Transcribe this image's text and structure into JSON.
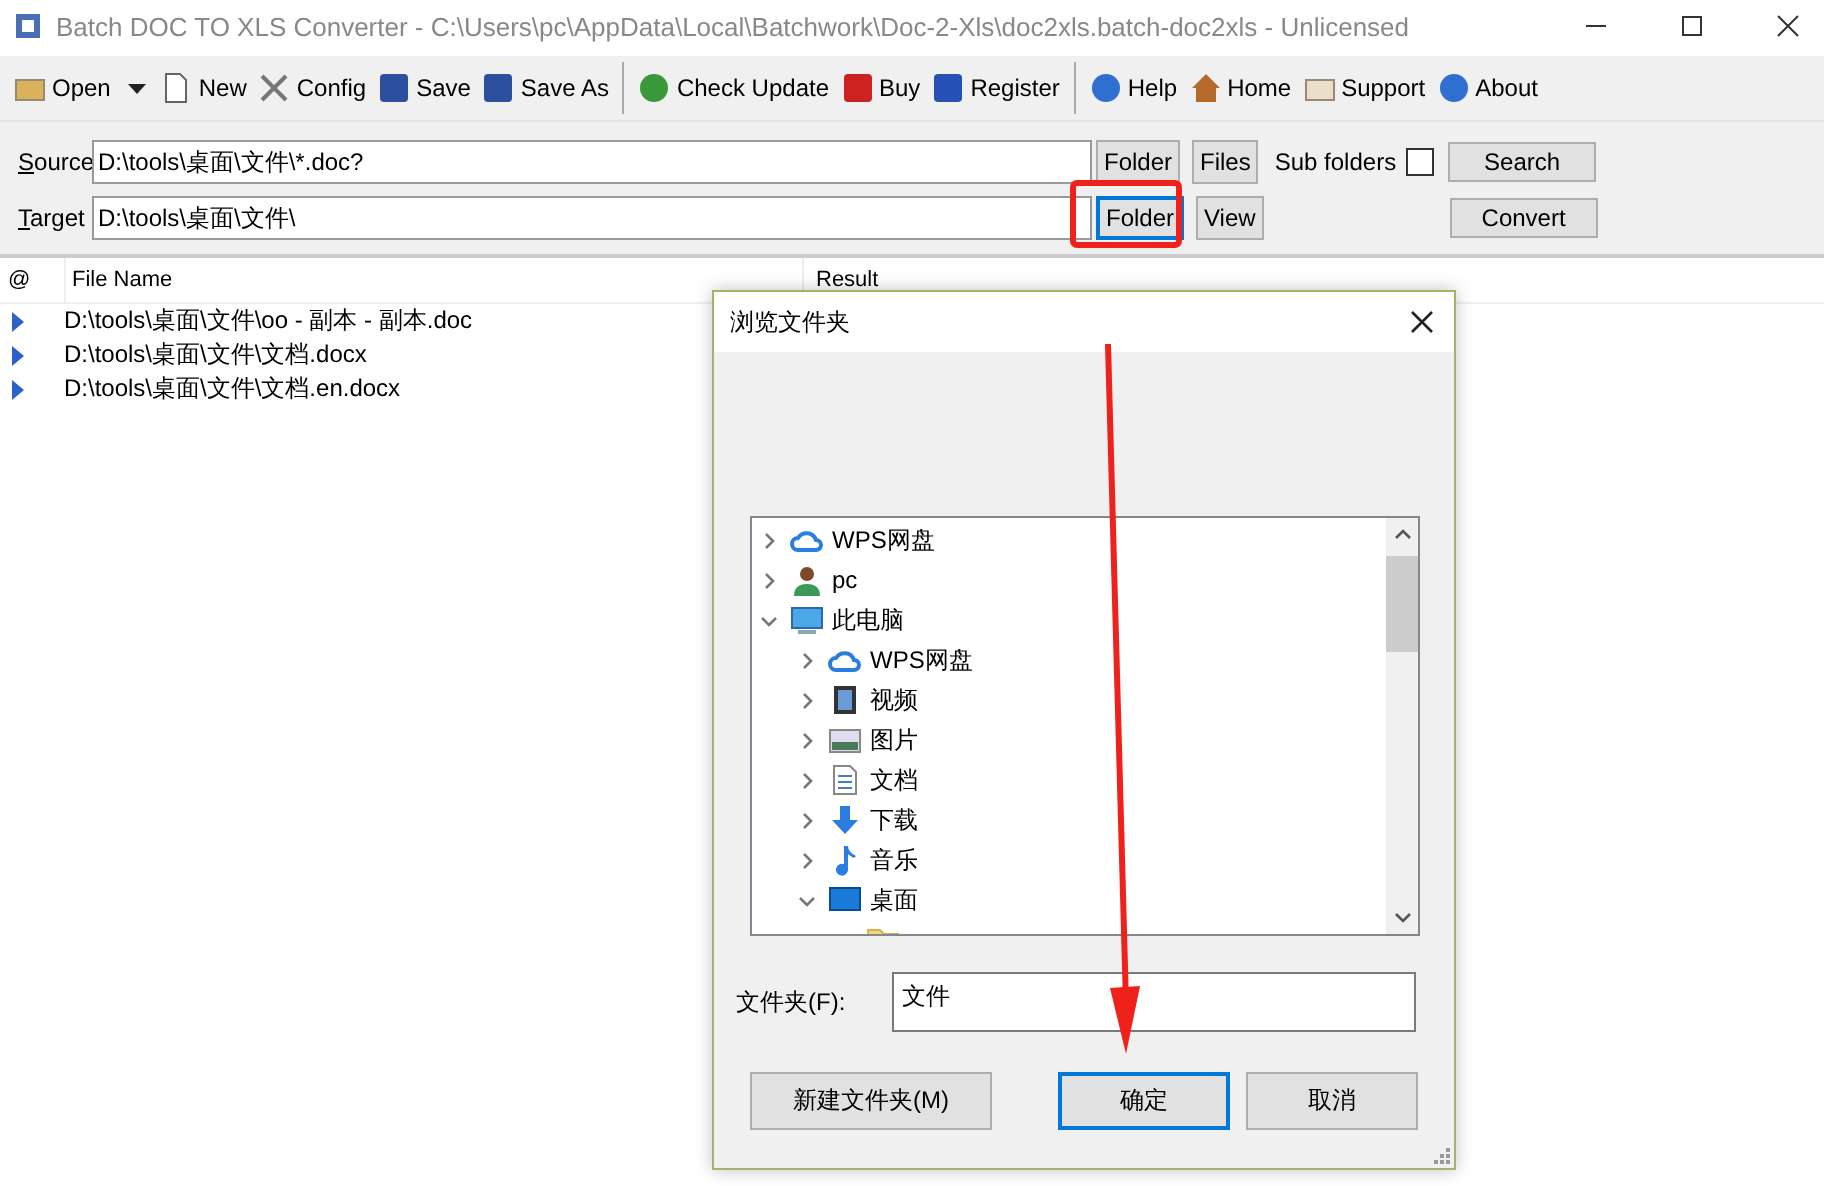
{
  "window": {
    "title": "Batch DOC TO XLS Converter - C:\\Users\\pc\\AppData\\Local\\Batchwork\\Doc-2-Xls\\doc2xls.batch-doc2xls - Unlicensed"
  },
  "toolbar": [
    [
      {
        "label": "Open",
        "kind": "open",
        "dropdown": true
      },
      {
        "label": "New",
        "kind": "new",
        "dropdown": false
      },
      {
        "label": "Config",
        "kind": "config",
        "dropdown": false
      },
      {
        "label": "Save",
        "kind": "save",
        "dropdown": false
      },
      {
        "label": "Save As",
        "kind": "saveas",
        "dropdown": false
      }
    ],
    [
      {
        "label": "Check Update",
        "kind": "update",
        "dropdown": false
      },
      {
        "label": "Buy",
        "kind": "buy",
        "dropdown": false
      },
      {
        "label": "Register",
        "kind": "register",
        "dropdown": false
      }
    ],
    [
      {
        "label": "Help",
        "kind": "help",
        "dropdown": false
      },
      {
        "label": "Home",
        "kind": "home",
        "dropdown": false
      },
      {
        "label": "Support",
        "kind": "support",
        "dropdown": false
      },
      {
        "label": "About",
        "kind": "about",
        "dropdown": false
      }
    ]
  ],
  "form": {
    "source": {
      "label": "Source",
      "value": "D:\\tools\\桌面\\文件\\*.doc?",
      "buttons": [
        {
          "label": "Folder",
          "focused": false
        },
        {
          "label": "Files",
          "focused": false
        }
      ]
    },
    "target": {
      "label": "Target",
      "value": "D:\\tools\\桌面\\文件\\",
      "buttons": [
        {
          "label": "Folder",
          "focused": true
        },
        {
          "label": "View",
          "focused": false
        }
      ]
    },
    "subfolders": {
      "label": "Sub folders",
      "checked": false
    },
    "search_button": "Search",
    "convert_button": "Convert"
  },
  "table": {
    "columns": [
      "@",
      "File Name",
      "Result"
    ],
    "rows": [
      {
        "file": "D:\\tools\\桌面\\文件\\oo - 副本 - 副本.doc"
      },
      {
        "file": "D:\\tools\\桌面\\文件\\文档.docx"
      },
      {
        "file": "D:\\tools\\桌面\\文件\\文档.en.docx"
      }
    ]
  },
  "dialog": {
    "title": "浏览文件夹",
    "tree": [
      {
        "label": "WPS网盘",
        "kind": "cloud",
        "expandable": true,
        "expanded": false
      },
      {
        "label": "pc",
        "kind": "user",
        "expandable": true,
        "expanded": false
      },
      {
        "label": "此电脑",
        "kind": "computer",
        "expandable": true,
        "expanded": true,
        "children": [
          {
            "label": "WPS网盘",
            "kind": "cloud",
            "expandable": true,
            "expanded": false
          },
          {
            "label": "视频",
            "kind": "video",
            "expandable": true,
            "expanded": false
          },
          {
            "label": "图片",
            "kind": "image",
            "expandable": true,
            "expanded": false
          },
          {
            "label": "文档",
            "kind": "document",
            "expandable": true,
            "expanded": false
          },
          {
            "label": "下载",
            "kind": "download",
            "expandable": true,
            "expanded": false
          },
          {
            "label": "音乐",
            "kind": "music",
            "expandable": true,
            "expanded": false
          },
          {
            "label": "桌面",
            "kind": "desktop",
            "expandable": true,
            "expanded": true,
            "children": [
              {
                "kind": "folder",
                "expandable": false
              }
            ]
          }
        ]
      }
    ],
    "folder_field": {
      "label": "文件夹(F):",
      "value": "文件"
    },
    "buttons": [
      {
        "label": "新建文件夹(M)",
        "default": false
      },
      {
        "label": "确定",
        "default": true
      },
      {
        "label": "取消",
        "default": false
      }
    ]
  }
}
